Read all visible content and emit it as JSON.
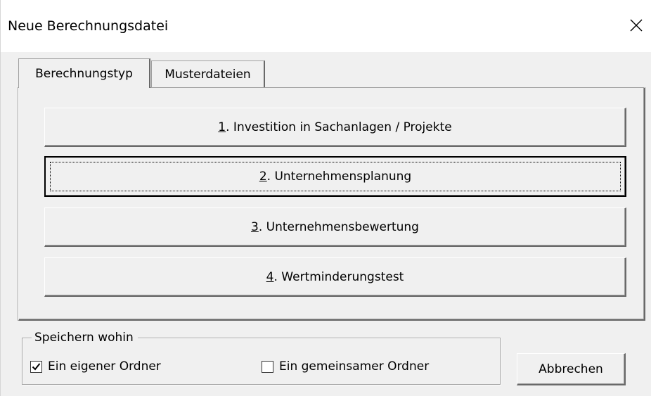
{
  "window": {
    "title": "Neue Berechnungsdatei"
  },
  "tabs": [
    {
      "label": "Berechnungstyp",
      "active": true
    },
    {
      "label": "Musterdateien",
      "active": false
    }
  ],
  "calculation_buttons": [
    {
      "mnemonic": "1",
      "label": ". Investition in Sachanlagen / Projekte"
    },
    {
      "mnemonic": "2",
      "label": ". Unternehmensplanung",
      "focused": true
    },
    {
      "mnemonic": "3",
      "label": ". Unternehmensbewertung"
    },
    {
      "mnemonic": "4",
      "label": ". Wertminderungstest"
    }
  ],
  "save_group": {
    "legend": "Speichern wohin",
    "own_folder": {
      "label": "Ein eigener Ordner",
      "checked": true
    },
    "shared_folder": {
      "label": "Ein gemeinsamer Ordner",
      "checked": false
    }
  },
  "actions": {
    "cancel_label": "Abbrechen"
  },
  "icons": {
    "close": "close-icon",
    "check": "checkmark-icon"
  },
  "colors": {
    "dialog_background": "#f0f0f0",
    "titlebar_background": "#ffffff",
    "border_dark": "#696969"
  }
}
